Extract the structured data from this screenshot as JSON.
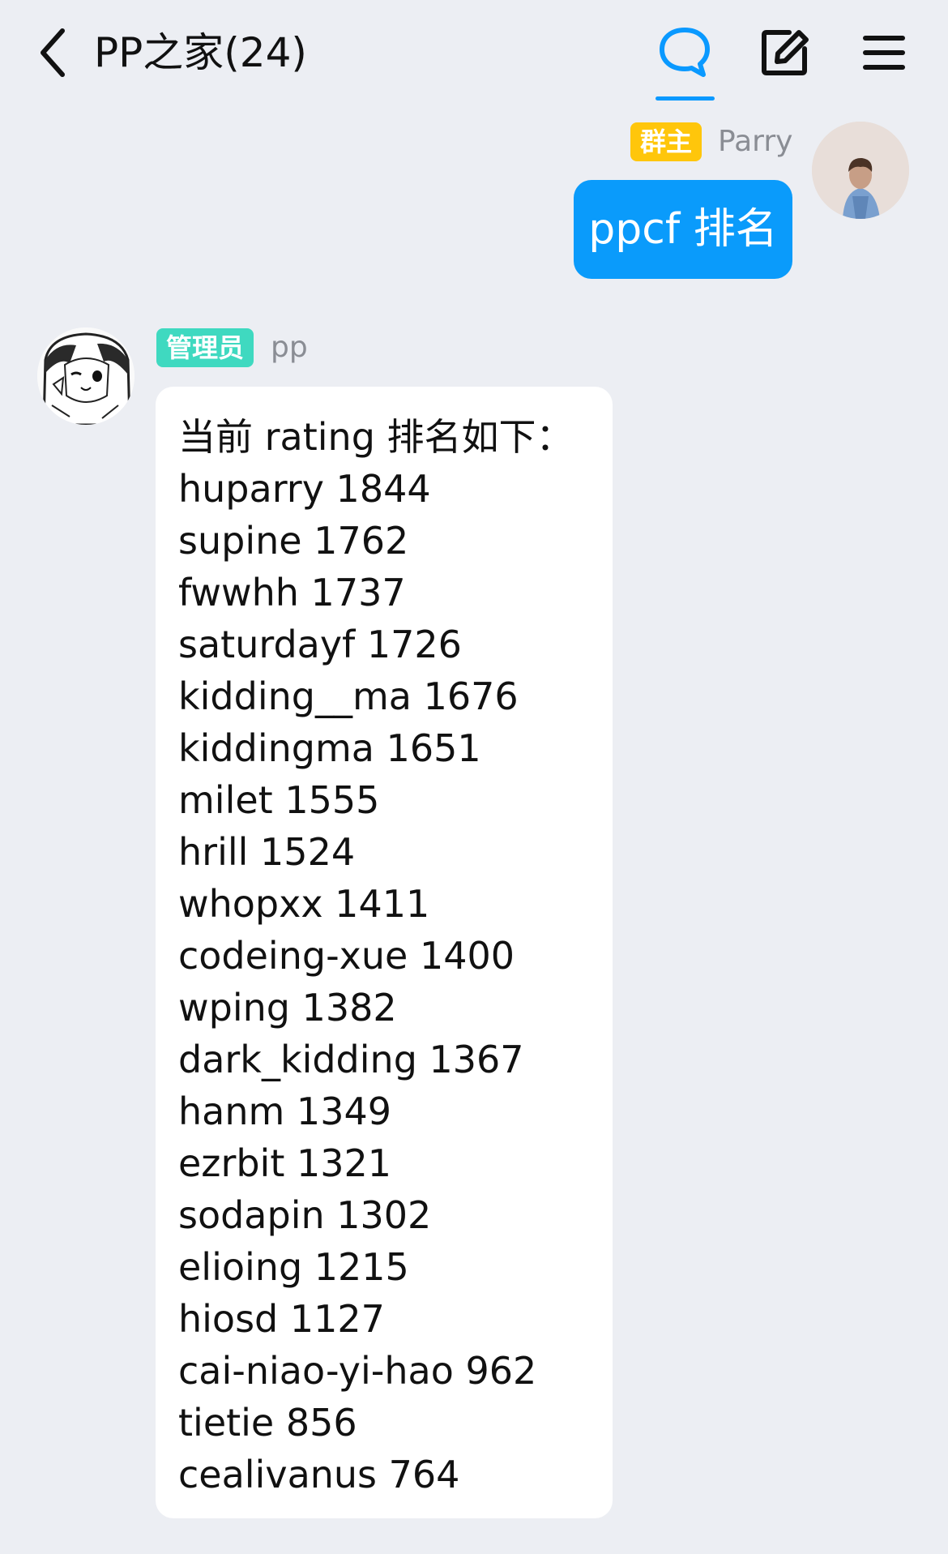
{
  "header": {
    "title": "PP之家(24)"
  },
  "messages": {
    "first": {
      "badge": "群主",
      "sender": "Parry",
      "text": "ppcf 排名"
    },
    "second": {
      "badge": "管理员",
      "sender": "pp",
      "lines": [
        "当前 rating 排名如下：",
        "huparry 1844",
        "supine 1762",
        "fwwhh 1737",
        "saturdayf 1726",
        "kidding__ma 1676",
        "kiddingma 1651",
        "milet 1555",
        "hrill 1524",
        "whopxx 1411",
        "codeing-xue 1400",
        "wping 1382",
        "dark_kidding 1367",
        "hanm 1349",
        "ezrbit 1321",
        "sodapin 1302",
        "elioing 1215",
        "hiosd 1127",
        "cai-niao-yi-hao 962",
        "tietie 856",
        "cealivanus 764"
      ]
    }
  },
  "colors": {
    "background": "#eceef3",
    "accent_blue": "#0a9bfb",
    "owner_badge": "#ffc60b",
    "admin_badge": "#3fd9c0"
  },
  "icons": {
    "back": "chevron-left-icon",
    "chat": "chat-bubble-icon",
    "edit": "edit-icon",
    "menu": "menu-icon"
  }
}
